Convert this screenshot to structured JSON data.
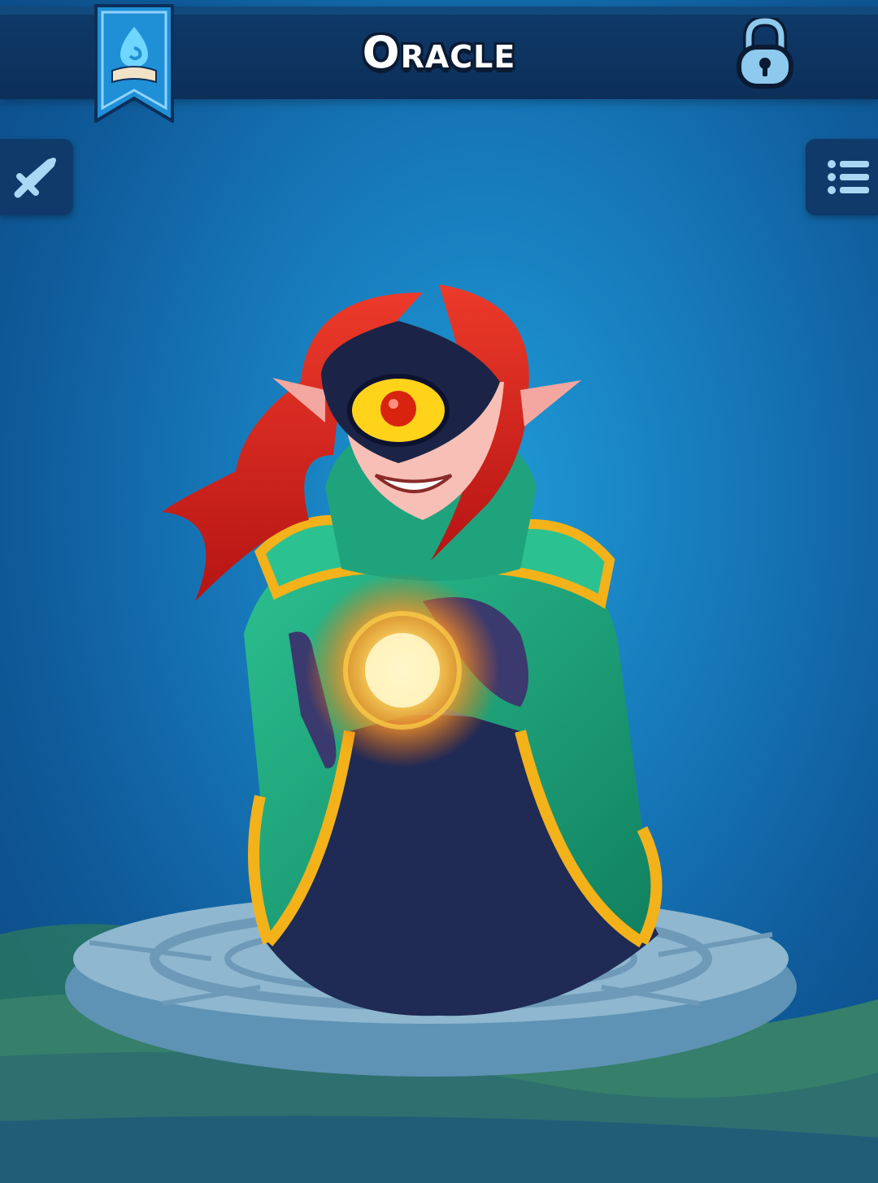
{
  "header": {
    "title": "Oracle",
    "codex_icon": "spellbook-ribbon-icon",
    "lock_icon": "padlock-icon"
  },
  "side_buttons": {
    "left_icon": "sword-icon",
    "right_icon": "list-icon"
  },
  "hero": {
    "portrait": "oracle-hero-artwork"
  },
  "colors": {
    "background": "#1677b8",
    "header_bar": "#0c2f59",
    "ribbon": "#1f8fd6",
    "icon_light": "#a9d8f5",
    "robe_green": "#1fa37c",
    "robe_trim": "#f3b21a",
    "hair": "#d5231f",
    "orb": "#ffd24a"
  }
}
